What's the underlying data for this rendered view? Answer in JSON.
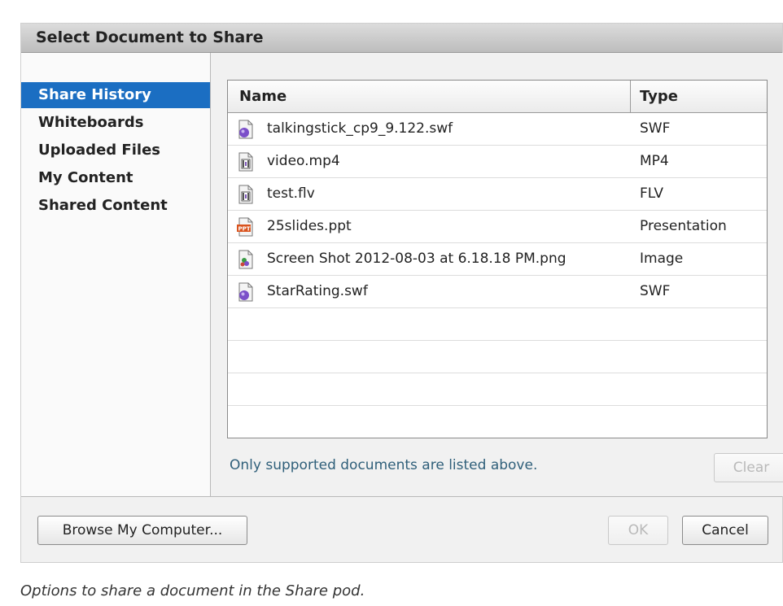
{
  "dialog": {
    "title": "Select Document to Share"
  },
  "sidebar": {
    "items": [
      {
        "label": "Share History",
        "active": true
      },
      {
        "label": "Whiteboards",
        "active": false
      },
      {
        "label": "Uploaded Files",
        "active": false
      },
      {
        "label": "My Content",
        "active": false
      },
      {
        "label": "Shared Content",
        "active": false
      }
    ]
  },
  "table": {
    "columns": [
      "Name",
      "Type"
    ],
    "rows": [
      {
        "icon": "swf-file-icon",
        "name": "talkingstick_cp9_9.122.swf",
        "type": "SWF"
      },
      {
        "icon": "video-file-icon",
        "name": "video.mp4",
        "type": "MP4"
      },
      {
        "icon": "video-file-icon",
        "name": "test.flv",
        "type": "FLV"
      },
      {
        "icon": "presentation-file-icon",
        "name": "25slides.ppt",
        "type": "Presentation"
      },
      {
        "icon": "image-file-icon",
        "name": "Screen Shot 2012-08-03 at 6.18.18 PM.png",
        "type": "Image"
      },
      {
        "icon": "swf-file-icon",
        "name": "StarRating.swf",
        "type": "SWF"
      }
    ]
  },
  "note": "Only supported documents are listed above.",
  "buttons": {
    "clear": "Clear",
    "browse": "Browse My Computer...",
    "ok": "OK",
    "cancel": "Cancel"
  },
  "caption": "Options to share a document in the Share pod.",
  "colors": {
    "selection": "#1b6ec2",
    "note_text": "#2f5f7a"
  }
}
